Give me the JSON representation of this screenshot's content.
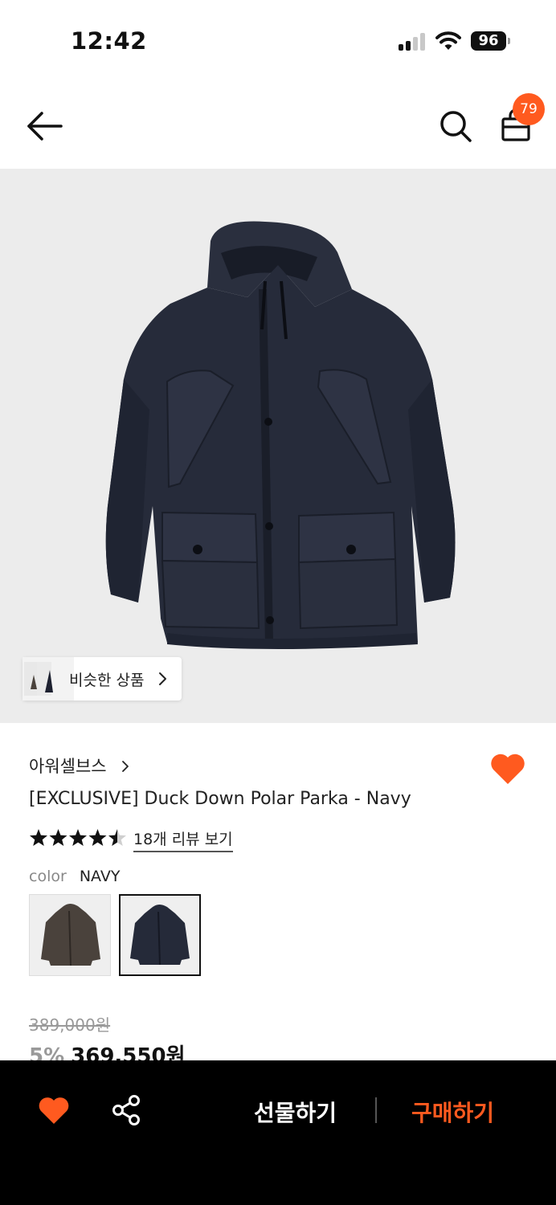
{
  "status_bar": {
    "time": "12:42",
    "battery": "96"
  },
  "header": {
    "cart_count": "79"
  },
  "hero": {
    "similar_label": "비슷한 상품"
  },
  "product": {
    "brand": "아워셀브스",
    "title": "[EXCLUSIVE] Duck Down Polar Parka - Navy",
    "rating": 4.5,
    "review_link": "18개 리뷰 보기",
    "color_key": "color",
    "color_value": "NAVY",
    "original_price": "389,000원",
    "discount": "5%",
    "price": "369,550원",
    "liked": true
  },
  "bottom_bar": {
    "gift_label": "선물하기",
    "buy_label": "구매하기"
  },
  "colors": {
    "accent": "#ff5a1f",
    "navy": "#252a39",
    "brown": "#4a423c"
  }
}
